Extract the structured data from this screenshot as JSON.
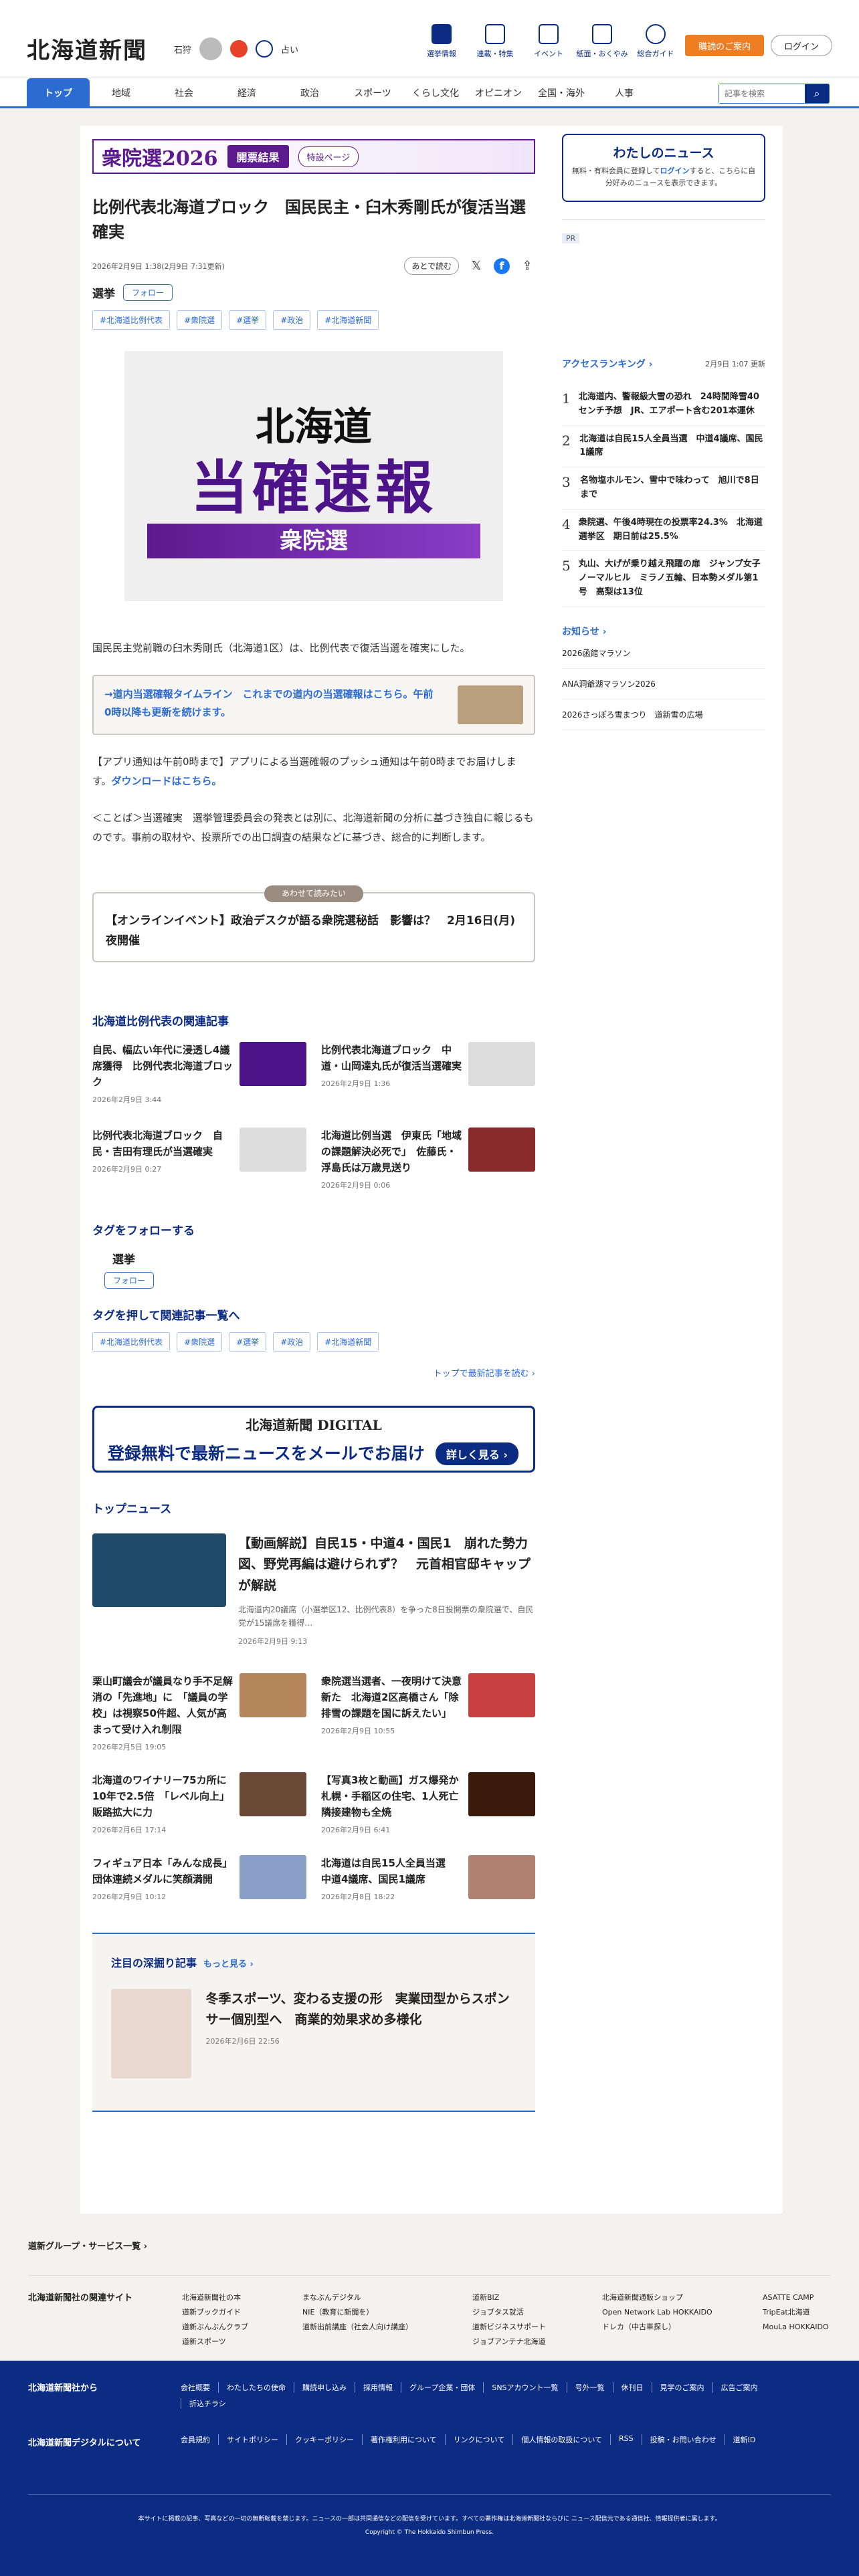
{
  "header": {
    "logo": "北海道新聞",
    "weather_city": "石狩",
    "weather_label": "占い",
    "icons": [
      "選挙情報",
      "連載・特集",
      "イベント",
      "紙面・おくやみ",
      "総合ガイド"
    ],
    "subscribe": "購読のご案内",
    "login": "ログイン"
  },
  "nav": {
    "items": [
      "トップ",
      "地域",
      "社会",
      "経済",
      "政治",
      "スポーツ",
      "くらし文化",
      "オピニオン",
      "全国・海外",
      "人事"
    ],
    "search_placeholder": "記事を検索"
  },
  "banner": {
    "logo": "衆院選2026",
    "result": "開票結果",
    "special": "特設ページ"
  },
  "article": {
    "title": "比例代表北海道ブロック　国民民主・臼木秀剛氏が復活当選確実",
    "date": "2026年2月9日 1:38(2月9日 7:31更新)",
    "later": "あとで読む",
    "category": "選挙",
    "follow": "フォロー",
    "tags": [
      "#北海道比例代表",
      "#衆院選",
      "#選挙",
      "#政治",
      "#北海道新聞"
    ],
    "hero_line1": "北海道",
    "hero_line2": "当確速報",
    "hero_line3": "衆院選",
    "lead": "国民民主党前職の臼木秀剛氏（北海道1区）は、比例代表で復活当選を確実にした。",
    "callout": "→道内当選確報タイムライン　これまでの道内の当選確報はこちら。午前0時以降も更新を続けます。",
    "app_prefix": "【アプリ通知は午前0時まで】アプリによる当選確報のプッシュ通知は午前0時までお届けします。",
    "app_link": "ダウンロードはこちら。",
    "note": "＜ことば＞当選確実　選挙管理委員会の発表とは別に、北海道新聞の分析に基づき独自に報じるものです。事前の取材や、投票所での出口調査の結果などに基づき、総合的に判断します。",
    "read_also_label": "あわせて読みたい",
    "read_also": "【オンラインイベント】政治デスクが語る衆院選秘話　影響は？　2月16日(月)夜開催"
  },
  "related": {
    "heading": "北海道比例代表の関連記事",
    "items": [
      {
        "title": "自民、幅広い年代に浸透し4議席獲得　比例代表北海道ブロック",
        "date": "2026年2月9日 3:44"
      },
      {
        "title": "比例代表北海道ブロック　中道・山岡達丸氏が復活当選確実",
        "date": "2026年2月9日 1:36"
      },
      {
        "title": "比例代表北海道ブロック　自民・吉田有理氏が当選確実",
        "date": "2026年2月9日 0:27"
      },
      {
        "title": "北海道比例当選　伊東氏「地域の課題解決必死で」　佐藤氏・浮島氏は万歳見送り",
        "date": "2026年2月9日 0:06"
      }
    ]
  },
  "follow_tags": {
    "heading": "タグをフォローする",
    "tag": "選挙",
    "follow": "フォロー",
    "list_heading": "タグを押して関連記事一覧へ",
    "more": "トップで最新記事を読む ›"
  },
  "mail": {
    "logo": "北海道新聞 DIGITAL",
    "text": "登録無料で最新ニュースをメールでお届け",
    "button": "詳しく見る ›"
  },
  "topnews": {
    "heading": "トップニュース",
    "main_title": "【動画解説】自民15・中道4・国民1　崩れた勢力図、野党再編は避けられず？　元首相官邸キャップが解説",
    "main_desc": "北海道内20議席（小選挙区12、比例代表8）を争った8日投開票の衆院選で、自民党が15議席を獲得…",
    "main_date": "2026年2月9日 9:13",
    "items": [
      {
        "title": "栗山町議会が議員なり手不足解消の「先進地」に　「議員の学校」は視察50件超、人気が高まって受け入れ制限",
        "date": "2026年2月5日 19:05"
      },
      {
        "title": "衆院選当選者、一夜明けて決意新た　北海道2区高橋さん「除排雪の課題を国に訴えたい」",
        "date": "2026年2月9日 10:55"
      },
      {
        "title": "北海道のワイナリー75カ所に　10年で2.5倍　「レベル向上」販路拡大に力",
        "date": "2026年2月6日 17:14"
      },
      {
        "title": "【写真3枚と動画】ガス爆発か　札幌・手稲区の住宅、1人死亡　隣接建物も全焼",
        "date": "2026年2月9日 6:41"
      },
      {
        "title": "フィギュア日本「みんな成長」団体連続メダルに笑顔満開",
        "date": "2026年2月9日 10:12"
      },
      {
        "title": "北海道は自民15人全員当選　中道4議席、国民1議席",
        "date": "2026年2月8日 18:22"
      }
    ]
  },
  "deep": {
    "heading": "注目の深掘り記事",
    "more": "もっと見る ›",
    "title": "冬季スポーツ、変わる支援の形　実業団型からスポンサー個別型へ　商業的効果求め多様化",
    "date": "2026年2月6日 22:56"
  },
  "sidebar": {
    "mynews_title": "わたしのニュース",
    "mynews_text1": "無料・有料会員に登録して",
    "mynews_link": "ログイン",
    "mynews_text2": "すると、こちらに自分好みのニュースを表示できます。",
    "pr": "PR",
    "rank_title": "アクセスランキング ›",
    "rank_date": "2月9日 1:07 更新",
    "ranking": [
      "北海道内、警報級大雪の恐れ　24時間降雪40センチ予想　JR、エアポート含む201本運休",
      "北海道は自民15人全員当選　中道4議席、国民1議席",
      "名物塩ホルモン、雪中で味わって　旭川で8日まで",
      "衆院選、午後4時現在の投票率24.3%　北海道選挙区　期日前は25.5%",
      "丸山、大げが乗り越え飛躍の扉　ジャンプ女子ノーマルヒル　ミラノ五輪、日本勢メダル第1号　高梨は13位"
    ],
    "notice_title": "お知らせ ›",
    "notices": [
      "2026函館マラソン",
      "ANA洞爺湖マラソン2026",
      "2026さっぽろ雪まつり　道新雪の広場"
    ]
  },
  "footer": {
    "group": "道新グループ・サービス一覧 ›",
    "sites_label": "北海道新聞社の関連サイト",
    "col1": [
      "北海道新聞社の本",
      "道新ブックガイド",
      "道新ぶんぶんクラブ",
      "道新スポーツ"
    ],
    "col2": [
      "まなぶんデジタル",
      "NIE（教育に新聞を）",
      "道新出前講座（社会人向け講座）"
    ],
    "col3": [
      "道新BIZ",
      "ジョブタス就活",
      "道新ビジネスサポート",
      "ジョブアンテナ北海道"
    ],
    "col4": [
      "北海道新聞通販ショップ",
      "Open Network Lab HOKKAIDO",
      "ドレカ（中古車探し）"
    ],
    "col5": [
      "ASATTE CAMP",
      "TripEat北海道",
      "MouLa HOKKAIDO"
    ],
    "from_label": "北海道新聞社から",
    "from_links": [
      "会社概要",
      "わたしたちの使命",
      "購読申し込み",
      "採用情報",
      "グループ企業・団体",
      "SNSアカウント一覧",
      "号外一覧",
      "休刊日",
      "見学のご案内",
      "広告ご案内",
      "折込チラシ"
    ],
    "digital_label": "北海道新聞デジタルについて",
    "digital_links": [
      "会員規約",
      "サイトポリシー",
      "クッキーポリシー",
      "著作権利用について",
      "リンクについて",
      "個人情報の取扱について",
      "RSS",
      "投稿・お問い合わせ",
      "道新ID"
    ],
    "notice": "本サイトに掲載の記事、写真などの一切の無断転載を禁じます。ニュースの一部は共同通信などの配信を受けています。すべての著作権は北海道新聞社ならびに ニュース配信元である通信社、情報提供者に属します。",
    "copyright": "Copyright © The Hokkaido Shimbun Press."
  }
}
